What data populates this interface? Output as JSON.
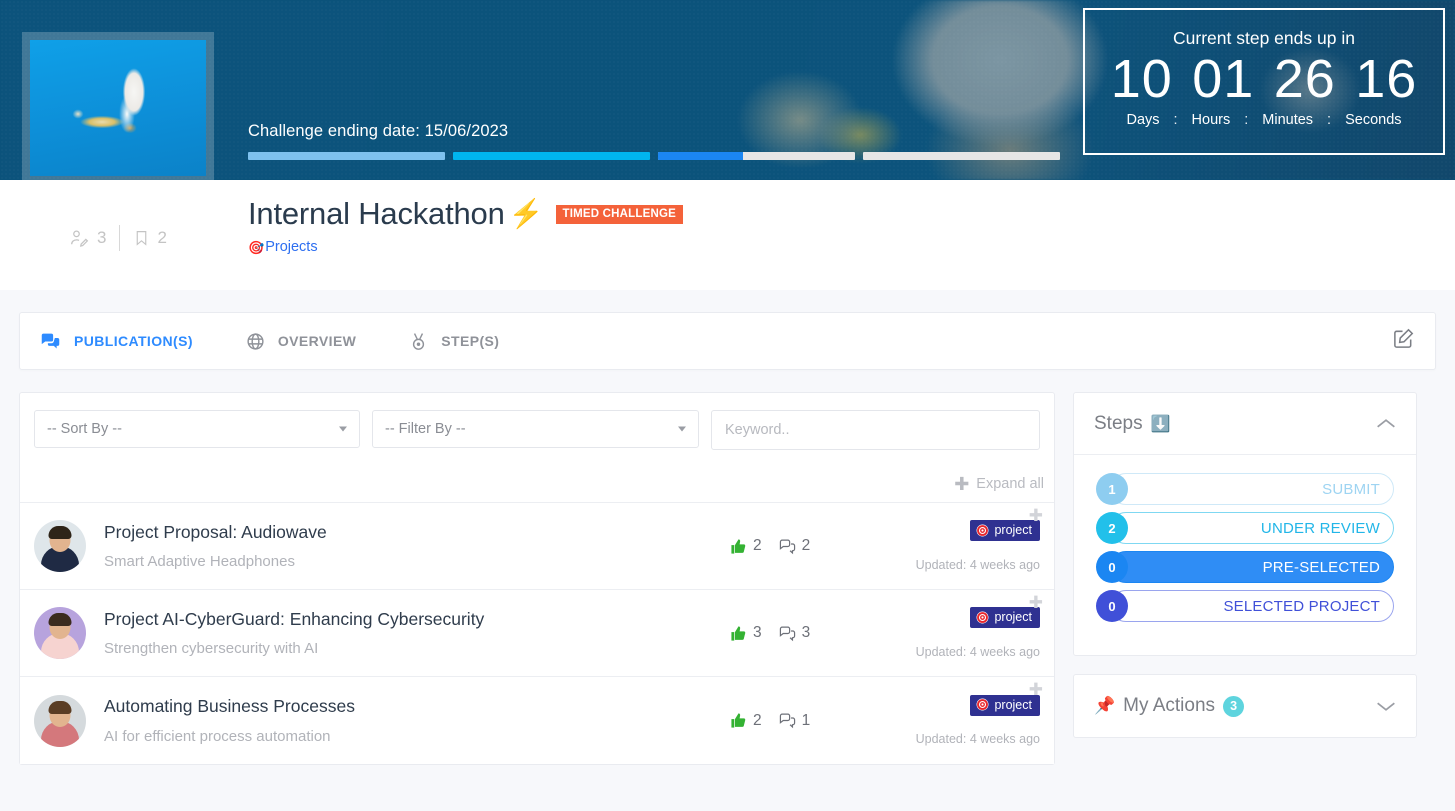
{
  "hero": {
    "challenge_date_label": "Challenge ending date: 15/06/2023",
    "thumbnail_alt": "lightbulb-thumbnail",
    "progress_bars": [
      {
        "name": "submit-progress",
        "percent": 100,
        "color": "#7ec1ee"
      },
      {
        "name": "under-review-progress",
        "percent": 100,
        "color": "#00b5ef"
      },
      {
        "name": "pre-selected-progress",
        "percent": 43,
        "color": "#1b86f2"
      },
      {
        "name": "selected-project-progress",
        "percent": 0,
        "color": "#e6e6e6"
      }
    ]
  },
  "countdown": {
    "title": "Current step ends up in",
    "days": "10",
    "hours": "01",
    "minutes": "26",
    "seconds": "16",
    "label_days": "Days",
    "label_hours": "Hours",
    "label_minutes": "Minutes",
    "label_seconds": "Seconds",
    "separator": ":"
  },
  "title_block": {
    "title": "Internal Hackathon",
    "bolt_icon": "⚡",
    "timed_badge": "TIMED CHALLENGE",
    "category_icon": "🎯",
    "category": "Projects",
    "participants_count": "3",
    "bookmarks_count": "2"
  },
  "tabs": [
    {
      "label": "PUBLICATION(S)",
      "icon": "comments-icon",
      "active": true
    },
    {
      "label": "OVERVIEW",
      "icon": "globe-icon",
      "active": false
    },
    {
      "label": "STEP(S)",
      "icon": "medal-icon",
      "active": false
    }
  ],
  "toolbar": {
    "edit_icon": "edit-square-icon"
  },
  "filters": {
    "sort_by": "-- Sort By --",
    "filter_by": "-- Filter By --",
    "keyword_value": "",
    "keyword_placeholder": "Keyword..",
    "expand_all": "Expand all"
  },
  "publications": [
    {
      "title": "Project Proposal: Audiowave",
      "subtitle": "Smart Adaptive Headphones",
      "likes": "2",
      "comments": "2",
      "badge": "project",
      "updated": "Updated: 4 weeks ago",
      "avatar_bg": "#dfe6ea",
      "avatar_shirt": "#1f2a44",
      "avatar_hair": "#2e2418"
    },
    {
      "title": "Project AI-CyberGuard: Enhancing Cybersecurity",
      "subtitle": "Strengthen cybersecurity with AI",
      "likes": "3",
      "comments": "3",
      "badge": "project",
      "updated": "Updated: 4 weeks ago",
      "avatar_bg": "#b7a3dd",
      "avatar_shirt": "#f6d3d0",
      "avatar_hair": "#3b2b1e"
    },
    {
      "title": "Automating Business Processes",
      "subtitle": "AI for efficient process automation",
      "likes": "2",
      "comments": "1",
      "badge": "project",
      "updated": "Updated: 4 weeks ago",
      "avatar_bg": "#d5dadd",
      "avatar_shirt": "#d4787c",
      "avatar_hair": "#5a3d24"
    }
  ],
  "steps_panel": {
    "title": "Steps",
    "title_icon": "⬇️",
    "collapse_icon": "chevron-up-icon",
    "steps": [
      {
        "count": "1",
        "label": "SUBMIT",
        "bubble": "#8ecdf0",
        "text": "#9ed4f2",
        "border": "#cfe9f8",
        "fill": "transparent",
        "filled": false
      },
      {
        "count": "2",
        "label": "UNDER REVIEW",
        "bubble": "#22c0ea",
        "text": "#22b6e8",
        "border": "#7fd8f2",
        "fill": "transparent",
        "filled": false
      },
      {
        "count": "0",
        "label": "PRE-SELECTED",
        "bubble": "#1b86f2",
        "text": "#ffffff",
        "border": "#1b86f2",
        "fill": "#2f8df5",
        "filled": true
      },
      {
        "count": "0",
        "label": "SELECTED PROJECT",
        "bubble": "#4050d8",
        "text": "#4050d8",
        "border": "#9aa5ee",
        "fill": "transparent",
        "filled": false
      }
    ]
  },
  "actions_panel": {
    "pin_icon": "📌",
    "title": "My Actions",
    "count": "3",
    "expand_icon": "chevron-down-icon"
  },
  "colors": {
    "accent_blue": "#2e8bff",
    "badge_orange": "#f4623a",
    "badge_navy": "#2f3191",
    "page_bg": "#f7f8fb",
    "hero_blue": "#0d5e8c"
  }
}
